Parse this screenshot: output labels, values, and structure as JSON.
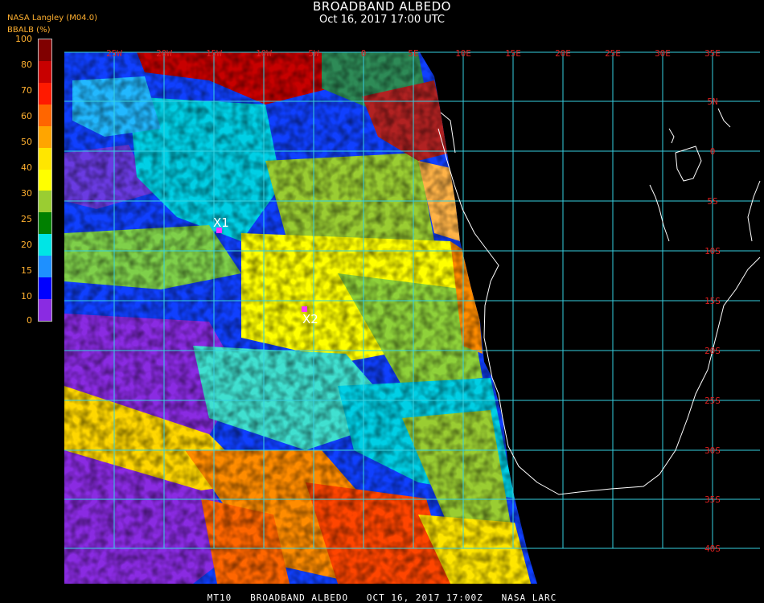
{
  "header": {
    "title": "BROADBAND ALBEDO",
    "subtitle": "Oct 16, 2017 17:00 UTC",
    "source": "NASA Langley (M04.0)"
  },
  "legend": {
    "title": "BBALB (%)",
    "ticks": [
      "100",
      "80",
      "70",
      "60",
      "50",
      "40",
      "30",
      "25",
      "20",
      "15",
      "10",
      "0"
    ],
    "tick_values": [
      100,
      80,
      70,
      60,
      50,
      40,
      30,
      25,
      20,
      15,
      10,
      0
    ],
    "colors": [
      "#800000",
      "#c80000",
      "#ff1a00",
      "#ff6600",
      "#ffa500",
      "#ffe600",
      "#ffff00",
      "#9acd32",
      "#008000",
      "#00e5e5",
      "#1e90ff",
      "#0000ff",
      "#8a2be2"
    ]
  },
  "map": {
    "grid_color": "#36d0e0",
    "coast_color": "#ffffff",
    "lon_labels": [
      "25W",
      "20W",
      "15W",
      "10W",
      "5W",
      "0",
      "5E",
      "10E",
      "15E",
      "20E",
      "25E",
      "30E",
      "35E"
    ],
    "lat_labels": [
      "5N",
      "0",
      "5S",
      "10S",
      "15S",
      "20S",
      "25S",
      "30S",
      "35S",
      "40S"
    ],
    "markers": [
      {
        "label": "X1",
        "color": "#ff33ff"
      },
      {
        "label": "X2",
        "color": "#ff33ff"
      }
    ]
  },
  "footer": "MT10   BROADBAND ALBEDO   OCT 16, 2017 17:00Z   NASA LARC"
}
